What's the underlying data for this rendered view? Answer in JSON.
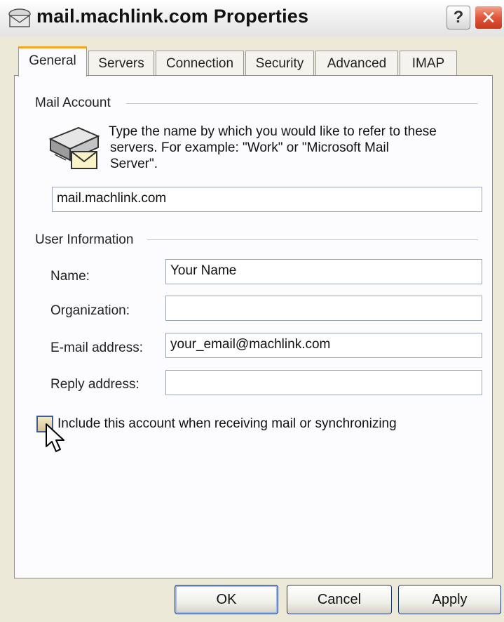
{
  "window": {
    "title": "mail.machlink.com Properties",
    "help_glyph": "?",
    "close_glyph": "✕"
  },
  "tabs": [
    {
      "label": "General",
      "active": true
    },
    {
      "label": "Servers"
    },
    {
      "label": "Connection"
    },
    {
      "label": "Security"
    },
    {
      "label": "Advanced"
    },
    {
      "label": "IMAP"
    }
  ],
  "mail_account": {
    "group_label": "Mail Account",
    "description_lines": [
      "Type the name by which you would like to refer to these",
      "servers.  For example: \"Work\" or \"Microsoft Mail",
      "Server\"."
    ],
    "account_name_value": "mail.machlink.com",
    "icon": "mail-server-icon"
  },
  "user_information": {
    "group_label": "User Information",
    "fields": [
      {
        "label": "Name:",
        "value": "Your Name"
      },
      {
        "label": "Organization:",
        "value": ""
      },
      {
        "label": "E-mail address:",
        "value": "your_email@machlink.com"
      },
      {
        "label": "Reply address:",
        "value": ""
      }
    ]
  },
  "include_checkbox": {
    "label": "Include this account when receiving mail or synchronizing",
    "checked": false
  },
  "buttons": {
    "ok": "OK",
    "cancel": "Cancel",
    "apply": "Apply"
  },
  "colors": {
    "accent_tab": "#f5a623",
    "close_red": "#e0573b",
    "face": "#ece9d8"
  }
}
